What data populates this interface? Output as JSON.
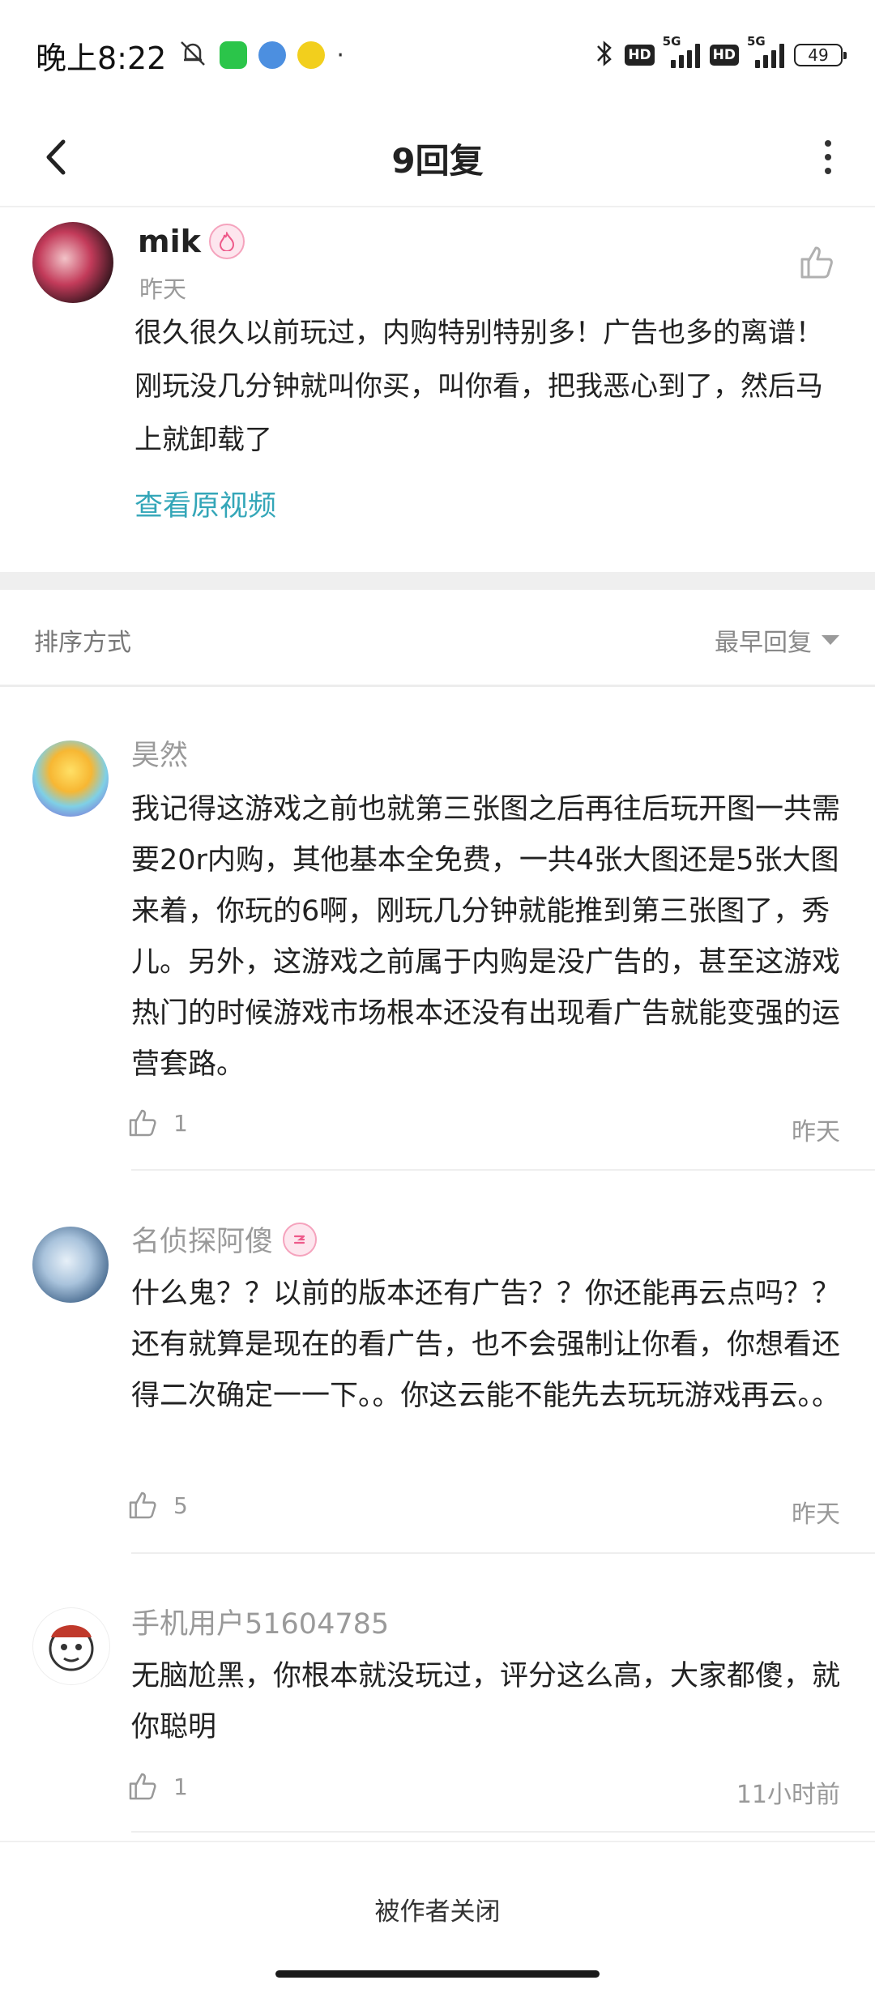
{
  "status_bar": {
    "time": "晚上8:22",
    "hd_label": "HD",
    "network_label": "5G",
    "battery": "49"
  },
  "header": {
    "title": "9回复"
  },
  "main_comment": {
    "username": "mik",
    "time": "昨天",
    "text": "很久很久以前玩过，内购特别特别多！广告也多的离谱！刚玩没几分钟就叫你买，叫你看，把我恶心到了，然后马上就卸载了",
    "link_text": "查看原视频"
  },
  "sort": {
    "label": "排序方式",
    "selected": "最早回复"
  },
  "replies": [
    {
      "username": "昊然",
      "text": "我记得这游戏之前也就第三张图之后再往后玩开图一共需要20r内购，其他基本全免费，一共4张大图还是5张大图来着，你玩的6啊，刚玩几分钟就能推到第三张图了，秀儿。另外，这游戏之前属于内购是没广告的，甚至这游戏热门的时候游戏市场根本还没有出现看广告就能变强的运营套路。",
      "likes": "1",
      "time": "昨天"
    },
    {
      "username": "名侦探阿傻",
      "text": "什么鬼？？以前的版本还有广告？？你还能再云点吗？？还有就算是现在的看广告，也不会强制让你看，你想看还得二次确定一一下。。你这云能不能先去玩玩游戏再云。。",
      "likes": "5",
      "time": "昨天"
    },
    {
      "username": "手机用户51604785",
      "text": "无脑尬黑，你根本就没玩过，评分这么高，大家都傻，就你聪明",
      "likes": "1",
      "time": "11小时前"
    }
  ],
  "footer": {
    "closed_text": "被作者关闭"
  },
  "colors": {
    "link": "#33a6b8",
    "muted_text": "#9a9a9a",
    "badge_pink": "#ee5a8a"
  }
}
